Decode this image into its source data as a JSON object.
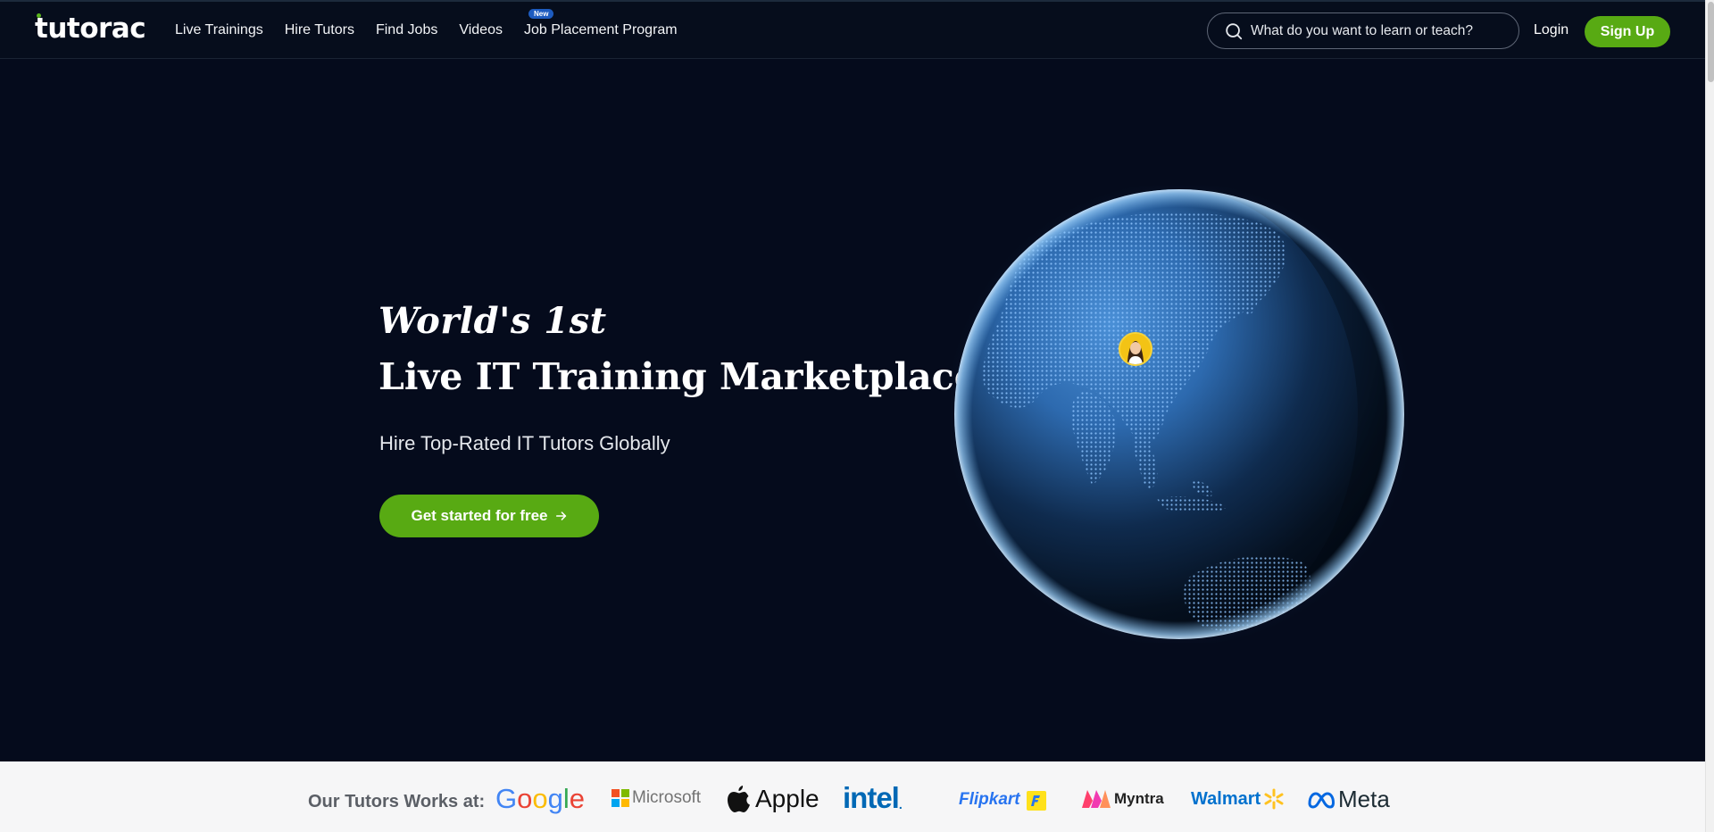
{
  "header": {
    "logo_text": "tutorac",
    "nav": [
      {
        "label": "Live Trainings"
      },
      {
        "label": "Hire Tutors"
      },
      {
        "label": "Find Jobs"
      },
      {
        "label": "Videos"
      },
      {
        "label": "Job Placement Program",
        "badge": "New"
      }
    ],
    "search": {
      "placeholder": "What do you want to learn or teach?"
    },
    "login_label": "Login",
    "signup_label": "Sign Up"
  },
  "hero": {
    "kicker": "World's 1st",
    "title": "Live IT Training Marketplace",
    "subtitle": "Hire Top-Rated IT Tutors Globally",
    "cta_label": "Get started for free"
  },
  "companies": {
    "label": "Our Tutors Works at:",
    "logos": [
      "Google",
      "Microsoft",
      "Apple",
      "intel",
      "Flipkart",
      "Myntra",
      "Walmart",
      "Meta"
    ]
  },
  "colors": {
    "background": "#050b1c",
    "accent_green": "#58aa13",
    "badge_blue": "#1d5bbf",
    "strip_bg": "#f6f6f7"
  },
  "icons": [
    "search-icon",
    "arrow-right-icon",
    "globe-icon",
    "avatar"
  ]
}
